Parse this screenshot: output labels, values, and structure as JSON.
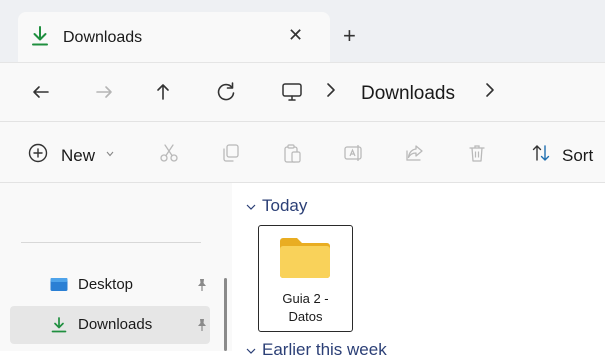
{
  "tab": {
    "title": "Downloads",
    "close_glyph": "✕",
    "new_tab_glyph": "+"
  },
  "navigation": {
    "back_icon": "arrow-left-icon",
    "forward_icon": "arrow-right-icon",
    "up_icon": "arrow-up-icon",
    "refresh_icon": "refresh-icon",
    "location_icon": "monitor-icon",
    "breadcrumb": [
      "Downloads"
    ]
  },
  "command_bar": {
    "new_label": "New",
    "sort_label": "Sort",
    "icons": [
      "plus-circle-icon",
      "cut-icon",
      "copy-icon",
      "paste-icon",
      "rename-icon",
      "share-icon",
      "delete-icon",
      "sort-icon"
    ]
  },
  "sidebar": {
    "items": [
      {
        "label": "Desktop",
        "icon": "desktop-icon",
        "pinned": true,
        "selected": false
      },
      {
        "label": "Downloads",
        "icon": "download-icon",
        "pinned": true,
        "selected": true
      }
    ]
  },
  "content": {
    "groups": [
      {
        "label": "Today",
        "expanded": true
      },
      {
        "label": "Earlier this week",
        "expanded": true
      }
    ],
    "files": [
      {
        "name_line1": "Guia 2 -",
        "name_line2": "Datos",
        "type": "folder"
      }
    ]
  },
  "colors": {
    "accent": "#1f8f3f",
    "group_header": "#2b3f76",
    "folder": "#f5c542",
    "selected_item": "#e6e6e6"
  }
}
